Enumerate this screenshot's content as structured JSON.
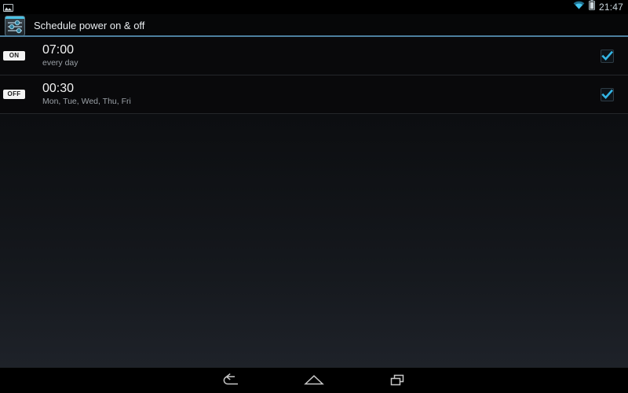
{
  "status_bar": {
    "notification_icon": "screenshot-image-icon",
    "wifi_icon": "wifi-icon",
    "battery_icon": "battery-icon",
    "clock": "21:47"
  },
  "action_bar": {
    "app_icon": "settings-sliders-icon",
    "title": "Schedule power on & off",
    "accent_color": "#4c7f9e"
  },
  "alarms": [
    {
      "state": "ON",
      "time": "07:00",
      "repeat": "every day",
      "enabled": true,
      "checkbox_icon": "checkbox-checked-icon"
    },
    {
      "state": "OFF",
      "time": "00:30",
      "repeat": "Mon, Tue, Wed, Thu, Fri",
      "enabled": true,
      "checkbox_icon": "checkbox-checked-icon"
    }
  ],
  "nav_bar": {
    "back": "back-icon",
    "home": "home-icon",
    "recents": "recents-icon"
  },
  "colors": {
    "accent": "#4c7f9e",
    "checkmark": "#33b5e5",
    "primary_text": "#f2f2f2",
    "secondary_text": "#9aa0a6"
  }
}
